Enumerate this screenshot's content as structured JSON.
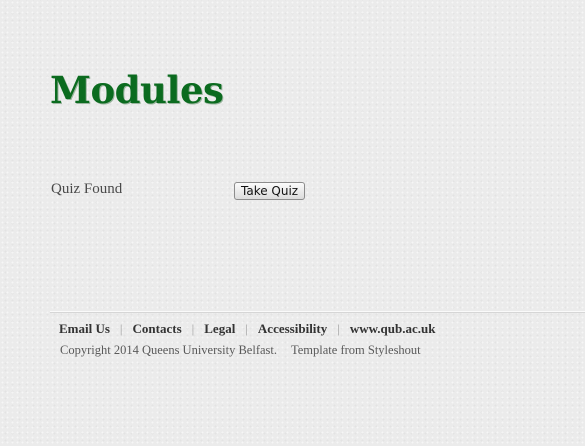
{
  "page": {
    "title": "Modules"
  },
  "quiz": {
    "status_label": "Quiz Found",
    "button_label": "Take Quiz"
  },
  "footer": {
    "links": [
      "Email Us",
      "Contacts",
      "Legal",
      "Accessibility",
      "www.qub.ac.uk"
    ],
    "separator": "|",
    "copyright": "Copyright 2014 Queens University Belfast.",
    "template_credit": "Template from Styleshout"
  },
  "colors": {
    "title": "#0b6b1f",
    "background": "#ebebeb"
  }
}
